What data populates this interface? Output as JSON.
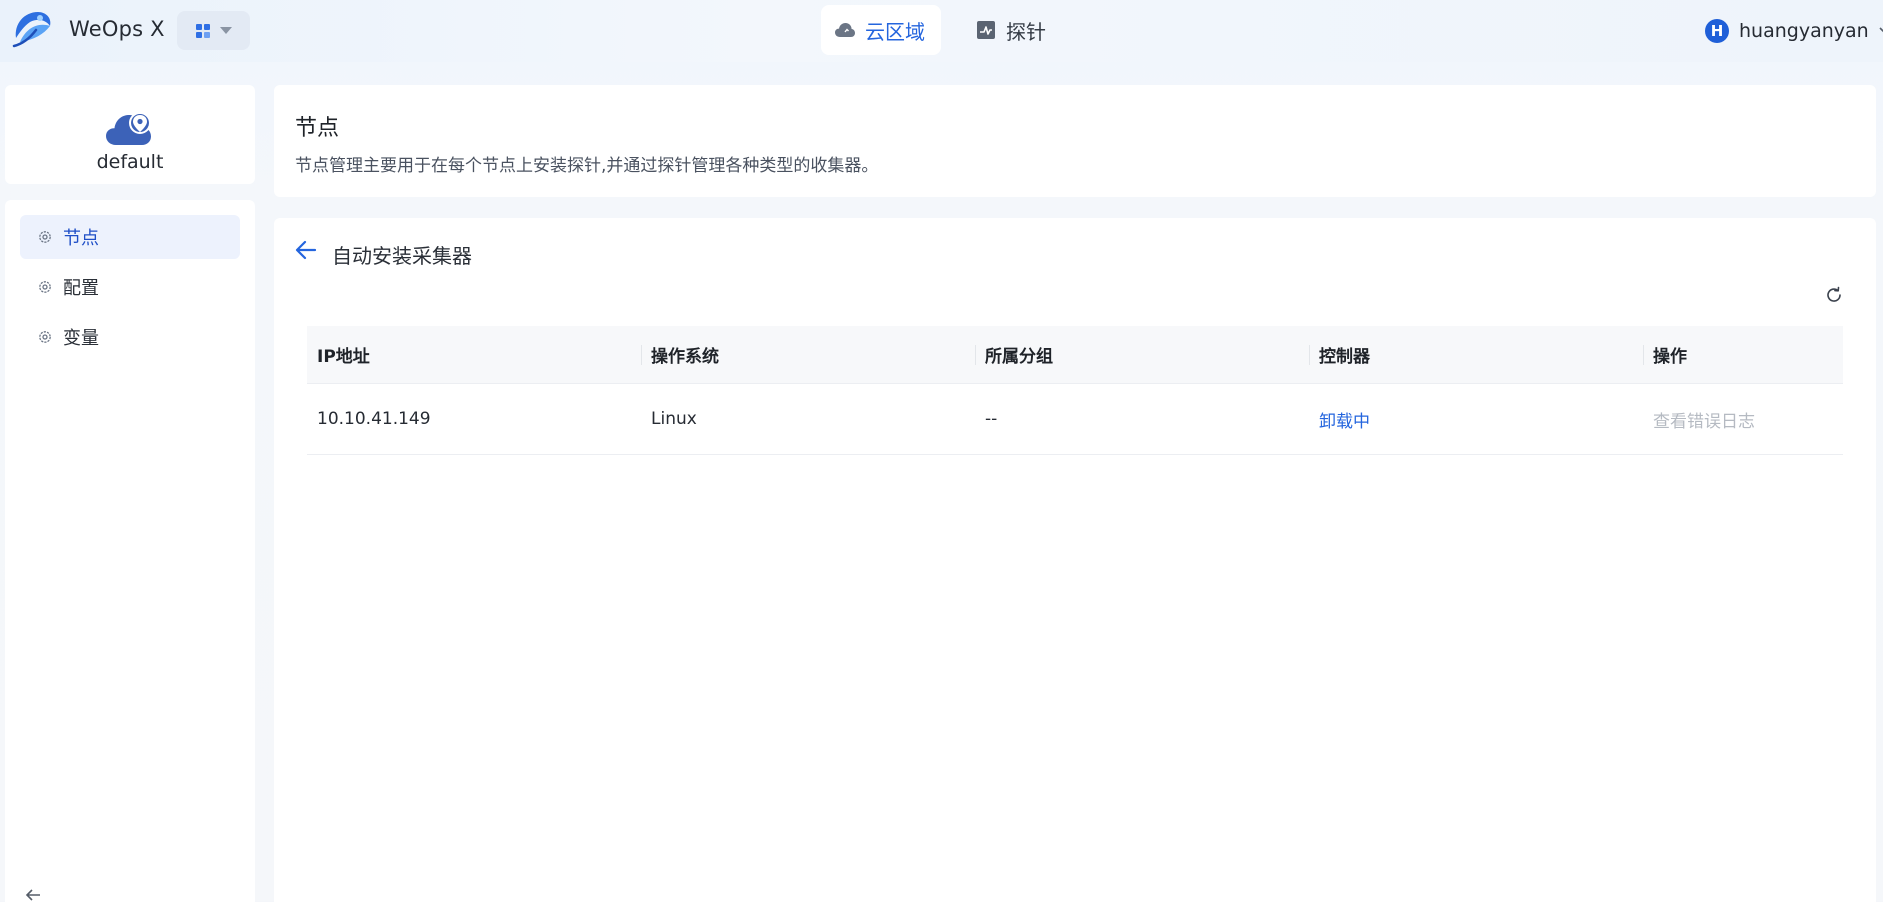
{
  "header": {
    "brand": "WeOps X",
    "tabs": [
      {
        "label": "云区域",
        "icon": "cloud-icon",
        "active": true
      },
      {
        "label": "探针",
        "icon": "probe-icon",
        "active": false
      }
    ],
    "user": {
      "avatar_letter": "H",
      "name": "huangyanyan"
    }
  },
  "sidebar": {
    "title": "default",
    "items": [
      {
        "label": "节点",
        "active": true
      },
      {
        "label": "配置",
        "active": false
      },
      {
        "label": "变量",
        "active": false
      }
    ]
  },
  "intro": {
    "title": "节点",
    "description": "节点管理主要用于在每个节点上安装探针,并通过探针管理各种类型的收集器。"
  },
  "main": {
    "title": "自动安装采集器",
    "table": {
      "columns": [
        "IP地址",
        "操作系统",
        "所属分组",
        "控制器",
        "操作"
      ],
      "rows": [
        {
          "ip": "10.10.41.149",
          "os": "Linux",
          "group": "--",
          "controller": "卸载中",
          "action": "查看错误日志"
        }
      ]
    }
  },
  "colors": {
    "accent": "#2465de",
    "active_menu_bg": "#edf2fd",
    "disabled_text": "#b5bac2"
  }
}
